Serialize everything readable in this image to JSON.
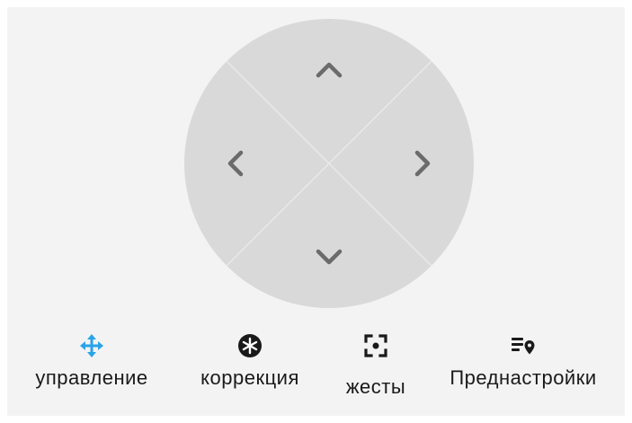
{
  "dpad": {
    "up_icon": "chevron-up-icon",
    "down_icon": "chevron-down-icon",
    "left_icon": "chevron-left-icon",
    "right_icon": "chevron-right-icon"
  },
  "tabs": [
    {
      "id": "control",
      "label": "управление",
      "icon": "move-arrows-icon",
      "active": true
    },
    {
      "id": "correction",
      "label": "коррекция",
      "icon": "snowflake-icon",
      "active": false
    },
    {
      "id": "gestures",
      "label": "жесты",
      "icon": "focus-frame-icon",
      "active": false
    },
    {
      "id": "presets",
      "label": "Преднастройки",
      "icon": "list-location-icon",
      "active": false
    }
  ],
  "colors": {
    "panel_bg": "#f3f3f3",
    "dpad_bg": "#d9d9d9",
    "arrow": "#6b6b6b",
    "accent": "#2aa3e8",
    "icon_dark": "#1a1a1a"
  }
}
